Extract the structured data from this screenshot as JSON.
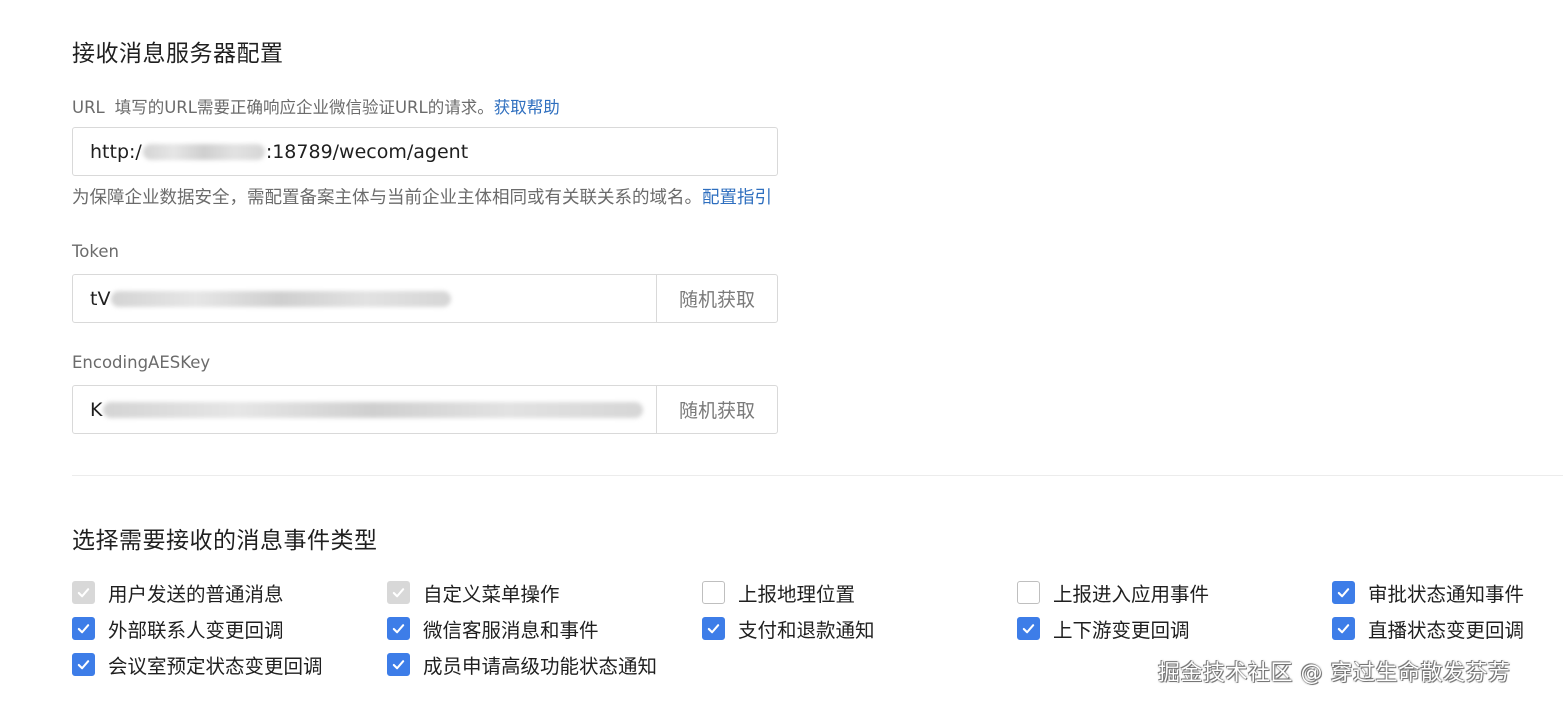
{
  "server_config": {
    "title": "接收消息服务器配置",
    "url_label": "URL",
    "url_hint": "填写的URL需要正确响应企业微信验证URL的请求。",
    "url_help_link": "获取帮助",
    "url_value_prefix": "http:/",
    "url_value_suffix": ":18789/wecom/agent",
    "domain_note": "为保障企业数据安全，需配置备案主体与当前企业主体相同或有关联关系的域名。",
    "domain_note_link": "配置指引",
    "token_label": "Token",
    "token_value_prefix": "tV",
    "token_random_button": "随机获取",
    "aes_label": "EncodingAESKey",
    "aes_value_prefix": "K",
    "aes_random_button": "随机获取"
  },
  "events": {
    "title": "选择需要接收的消息事件类型",
    "items": [
      {
        "label": "用户发送的普通消息",
        "state": "checked-disabled"
      },
      {
        "label": "自定义菜单操作",
        "state": "checked-disabled"
      },
      {
        "label": "上报地理位置",
        "state": "unchecked"
      },
      {
        "label": "上报进入应用事件",
        "state": "unchecked"
      },
      {
        "label": "审批状态通知事件",
        "state": "checked"
      },
      {
        "label": "外部联系人变更回调",
        "state": "checked"
      },
      {
        "label": "微信客服消息和事件",
        "state": "checked"
      },
      {
        "label": "支付和退款通知",
        "state": "checked"
      },
      {
        "label": "上下游变更回调",
        "state": "checked"
      },
      {
        "label": "直播状态变更回调",
        "state": "checked"
      },
      {
        "label": "会议室预定状态变更回调",
        "state": "checked"
      },
      {
        "label": "成员申请高级功能状态通知",
        "state": "checked"
      }
    ]
  },
  "watermark": "掘金技术社区 @ 穿过生命散发芬芳",
  "colors": {
    "accent": "#3d7de8",
    "link": "#2f6fbf",
    "disabled_check": "#d8d8d8"
  }
}
